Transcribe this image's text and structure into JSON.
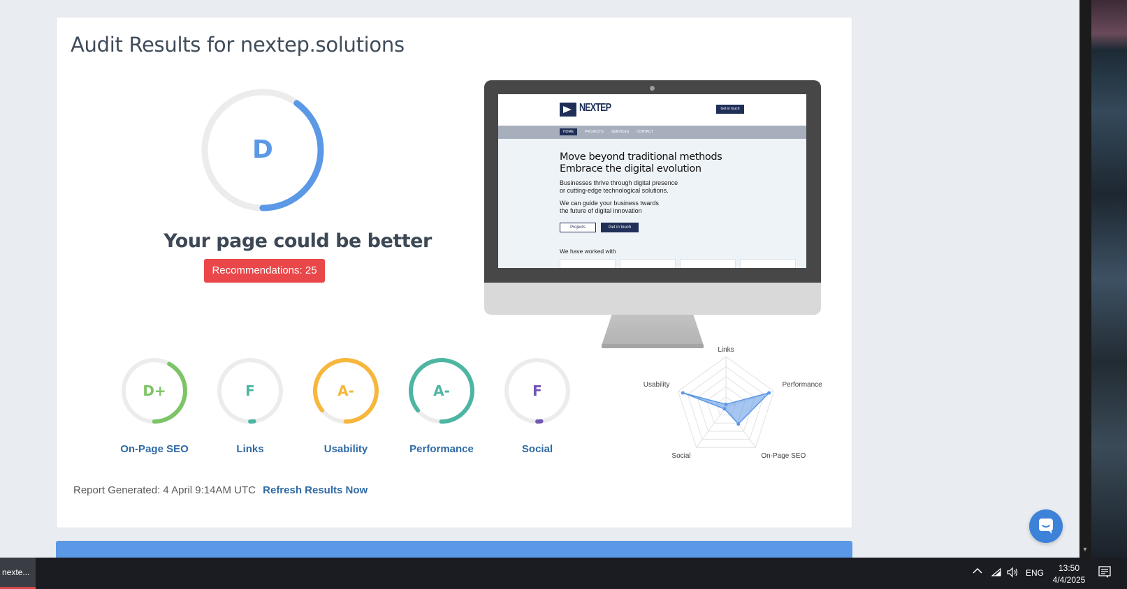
{
  "audit": {
    "title": "Audit Results for nextep.solutions",
    "overall_grade": "D",
    "overall_score": 0.4,
    "verdict": "Your page could be better",
    "recommendations_label": "Recommendations: 25",
    "report_generated": "Report Generated: 4 April 9:14AM UTC",
    "refresh_label": "Refresh Results Now"
  },
  "preview_site": {
    "logo_text": "NEXTEP",
    "header_button": "Get in touch",
    "nav": [
      "HOME",
      "PROJECTS",
      "SERVICES",
      "CONTACT"
    ],
    "headline_1": "Move beyond traditional methods",
    "headline_2": "Embrace the digital evolution",
    "para_1a": "Businesses thrive through digital presence",
    "para_1b": "or cutting-edge technological solutions.",
    "para_2a": "We can guide your business twards",
    "para_2b": "the future of digital innovation",
    "btn_projects": "Projects",
    "btn_get": "Get in touch",
    "worked_with": "We have worked with"
  },
  "grades": [
    {
      "label": "On-Page SEO",
      "grade": "D+",
      "score": 0.42,
      "color": "#7cc465"
    },
    {
      "label": "Links",
      "grade": "F",
      "score": 0.02,
      "color": "#4db6a2"
    },
    {
      "label": "Usability",
      "grade": "A-",
      "score": 0.86,
      "color": "#f6b73c"
    },
    {
      "label": "Performance",
      "grade": "A-",
      "score": 0.86,
      "color": "#4db6a2"
    },
    {
      "label": "Social",
      "grade": "F",
      "score": 0.02,
      "color": "#7256b5"
    }
  ],
  "chart_data": {
    "type": "radar",
    "axes": [
      "Links",
      "Performance",
      "On-Page SEO",
      "Social",
      "Usability"
    ],
    "values": [
      5,
      90,
      42,
      5,
      90
    ],
    "range": [
      0,
      100
    ],
    "color": "#5b98e6"
  },
  "colors": {
    "main_grade": "#5b98e6",
    "ring_track": "#ececec",
    "badge": "#e9474a",
    "link": "#2f6aa5"
  },
  "taskbar": {
    "app_label": "nexte...",
    "language": "ENG",
    "time": "13:50",
    "date": "4/4/2025"
  }
}
